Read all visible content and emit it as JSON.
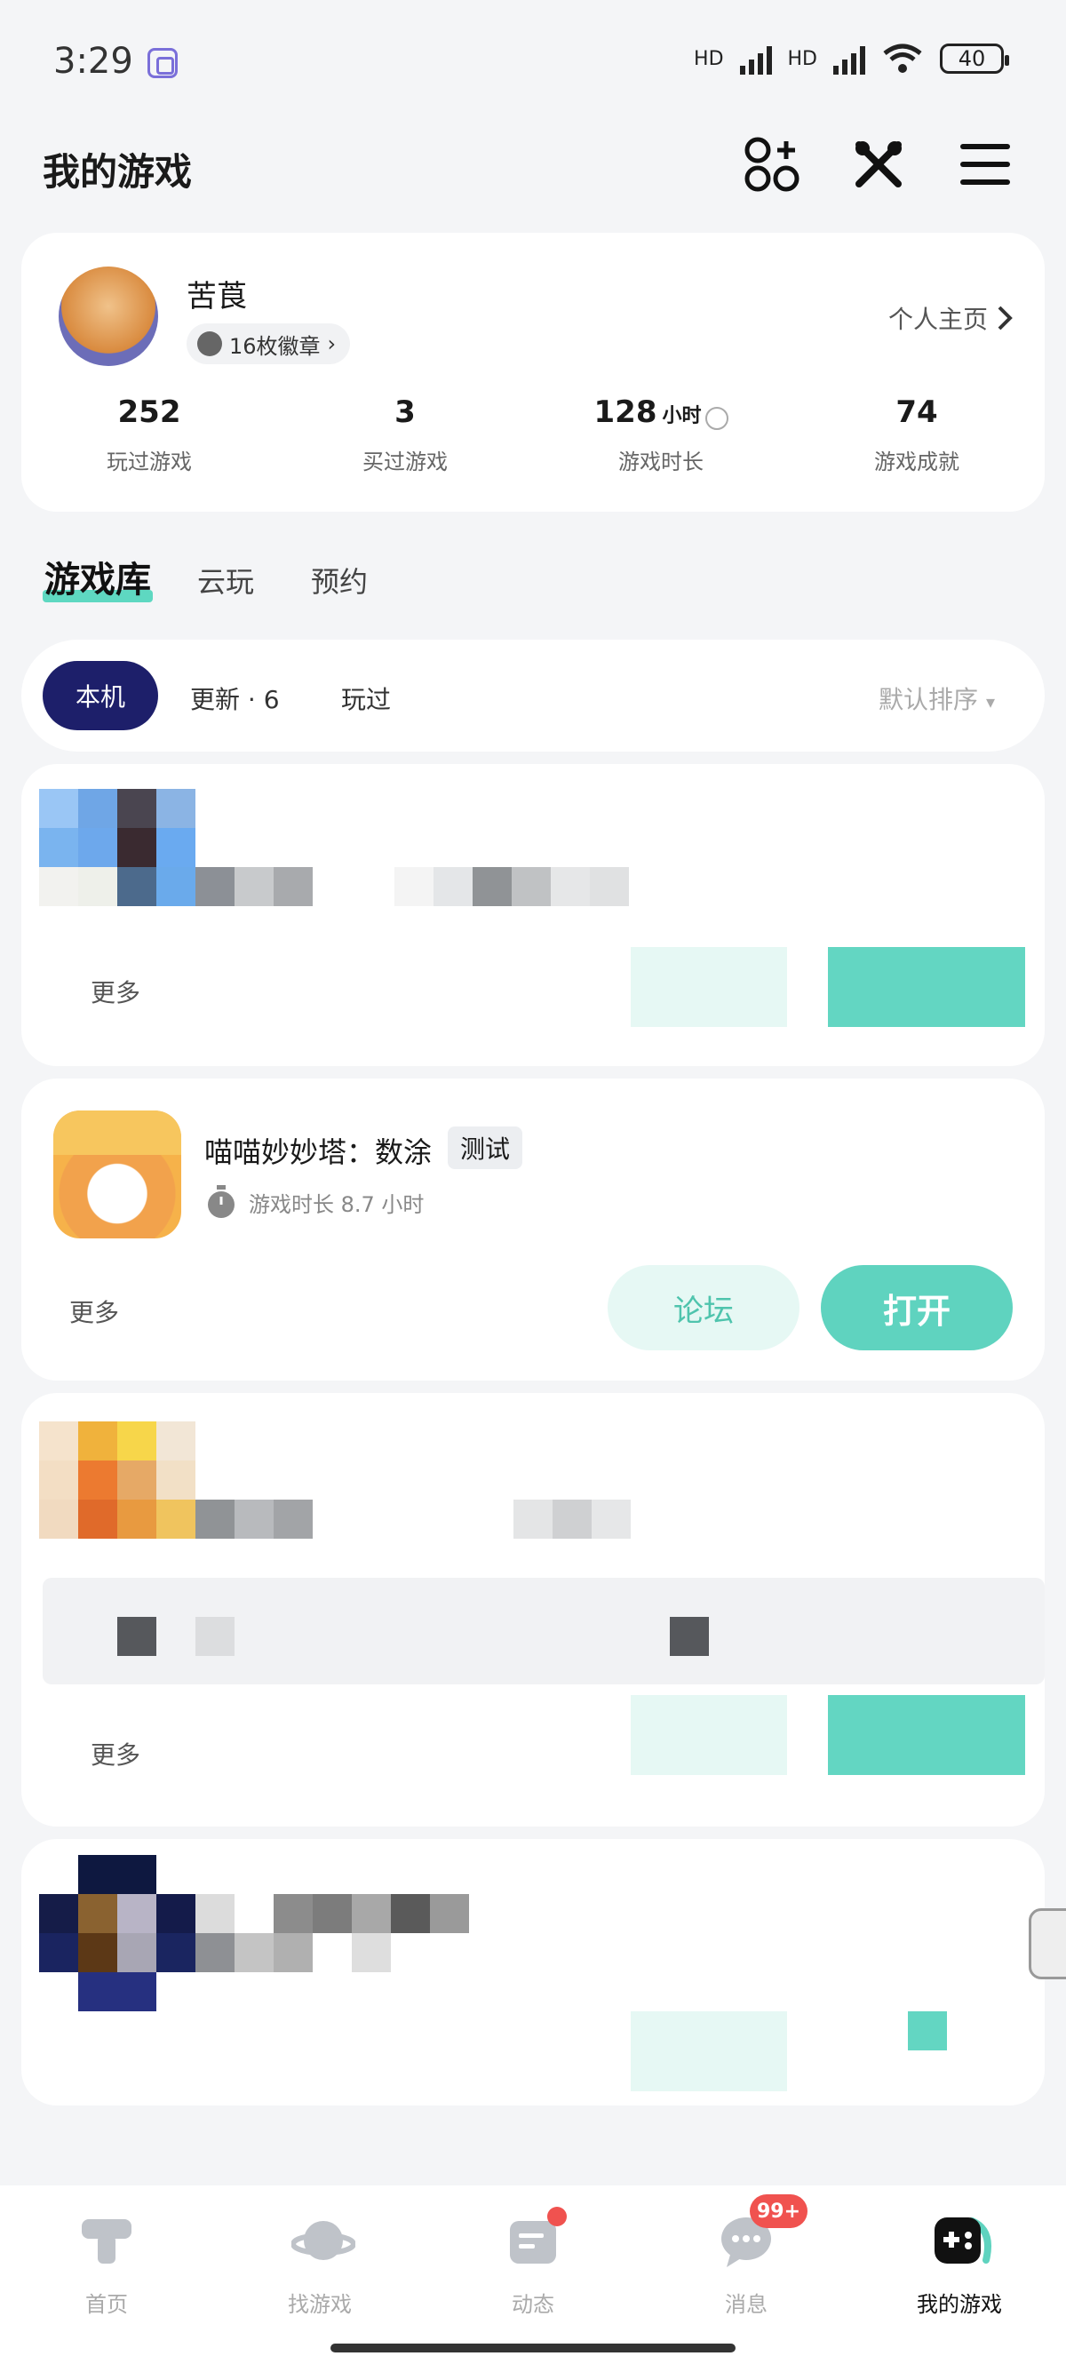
{
  "status_bar": {
    "time": "3:29",
    "battery": "40",
    "net1": "HD",
    "net2": "HD"
  },
  "header": {
    "title": "我的游戏"
  },
  "profile": {
    "username": "苦莨",
    "badge_text": "16枚徽章",
    "profile_link": "个人主页",
    "stats": [
      {
        "value": "252",
        "unit": "",
        "label": "玩过游戏"
      },
      {
        "value": "3",
        "unit": "",
        "label": "买过游戏"
      },
      {
        "value": "128",
        "unit": "小时",
        "label": "游戏时长"
      },
      {
        "value": "74",
        "unit": "",
        "label": "游戏成就"
      }
    ]
  },
  "tabs": [
    {
      "label": "游戏库"
    },
    {
      "label": "云玩"
    },
    {
      "label": "预约"
    }
  ],
  "filters": {
    "local": "本机",
    "updates": "更新 · 6",
    "played": "玩过",
    "sort": "默认排序"
  },
  "games": [
    {
      "more": "更多"
    },
    {
      "name": "喵喵妙妙塔：数涂",
      "tag": "测试",
      "playtime": "游戏时长 8.7 小时",
      "more": "更多",
      "forum": "论坛",
      "open": "打开"
    },
    {
      "more": "更多"
    }
  ],
  "bottom_nav": [
    {
      "label": "首页"
    },
    {
      "label": "找游戏"
    },
    {
      "label": "动态"
    },
    {
      "label": "消息",
      "badge": "99+"
    },
    {
      "label": "我的游戏"
    }
  ],
  "colors": {
    "accent": "#5fd3bf",
    "navy": "#1d1f6a",
    "badge_red": "#f0524f"
  }
}
